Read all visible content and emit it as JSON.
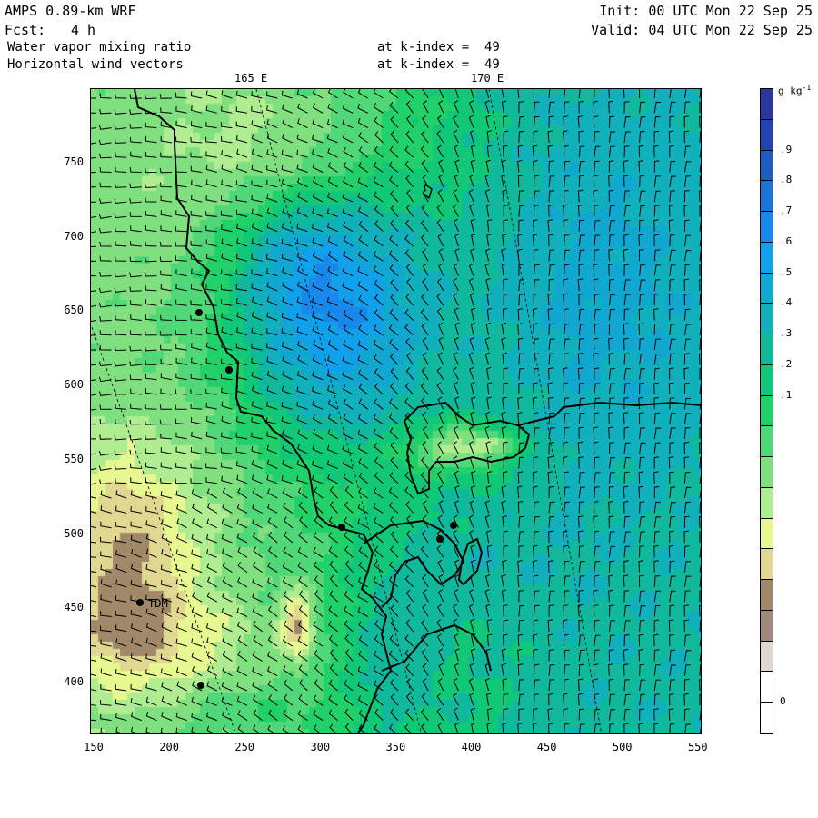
{
  "header": {
    "model": "AMPS 0.89-km WRF",
    "forecast_label": "Fcst:",
    "forecast_value": "4 h",
    "init": "Init: 00 UTC Mon 22 Sep 25",
    "valid": "Valid: 04 UTC Mon 22 Sep 25",
    "field1": "Water vapor mixing ratio",
    "field1_level": "at k-index =  49",
    "field2": "Horizontal wind vectors",
    "field2_level": "at k-index =  49"
  },
  "longitude_labels": [
    "165 E",
    "170 E"
  ],
  "x_ticks": [
    "150",
    "200",
    "250",
    "300",
    "350",
    "400",
    "450",
    "500",
    "550"
  ],
  "y_ticks": [
    "750",
    "700",
    "650",
    "600",
    "550",
    "500",
    "450",
    "400"
  ],
  "colorbar": {
    "units": "g kg",
    "units_exp": "-1",
    "labels": [
      ".9",
      ".8",
      ".7",
      ".6",
      ".5",
      ".4",
      ".3",
      ".2",
      ".1",
      "0"
    ],
    "colors_top_to_bottom": [
      "#2a3a9c",
      "#2244b0",
      "#1e5cc4",
      "#1c74d8",
      "#1888ec",
      "#10a0ec",
      "#10a8d0",
      "#10b0bc",
      "#10b89c",
      "#10c878",
      "#20d068",
      "#50d878",
      "#80e080",
      "#b0ec90",
      "#e8f890",
      "#e0d890",
      "#a08868",
      "#a08880",
      "#e0d8d0",
      "#ffffff",
      "#ffffff"
    ]
  },
  "stations": [
    {
      "label": "TDM"
    }
  ],
  "colors": {
    "coast": "#000000",
    "barb": "#000000"
  }
}
